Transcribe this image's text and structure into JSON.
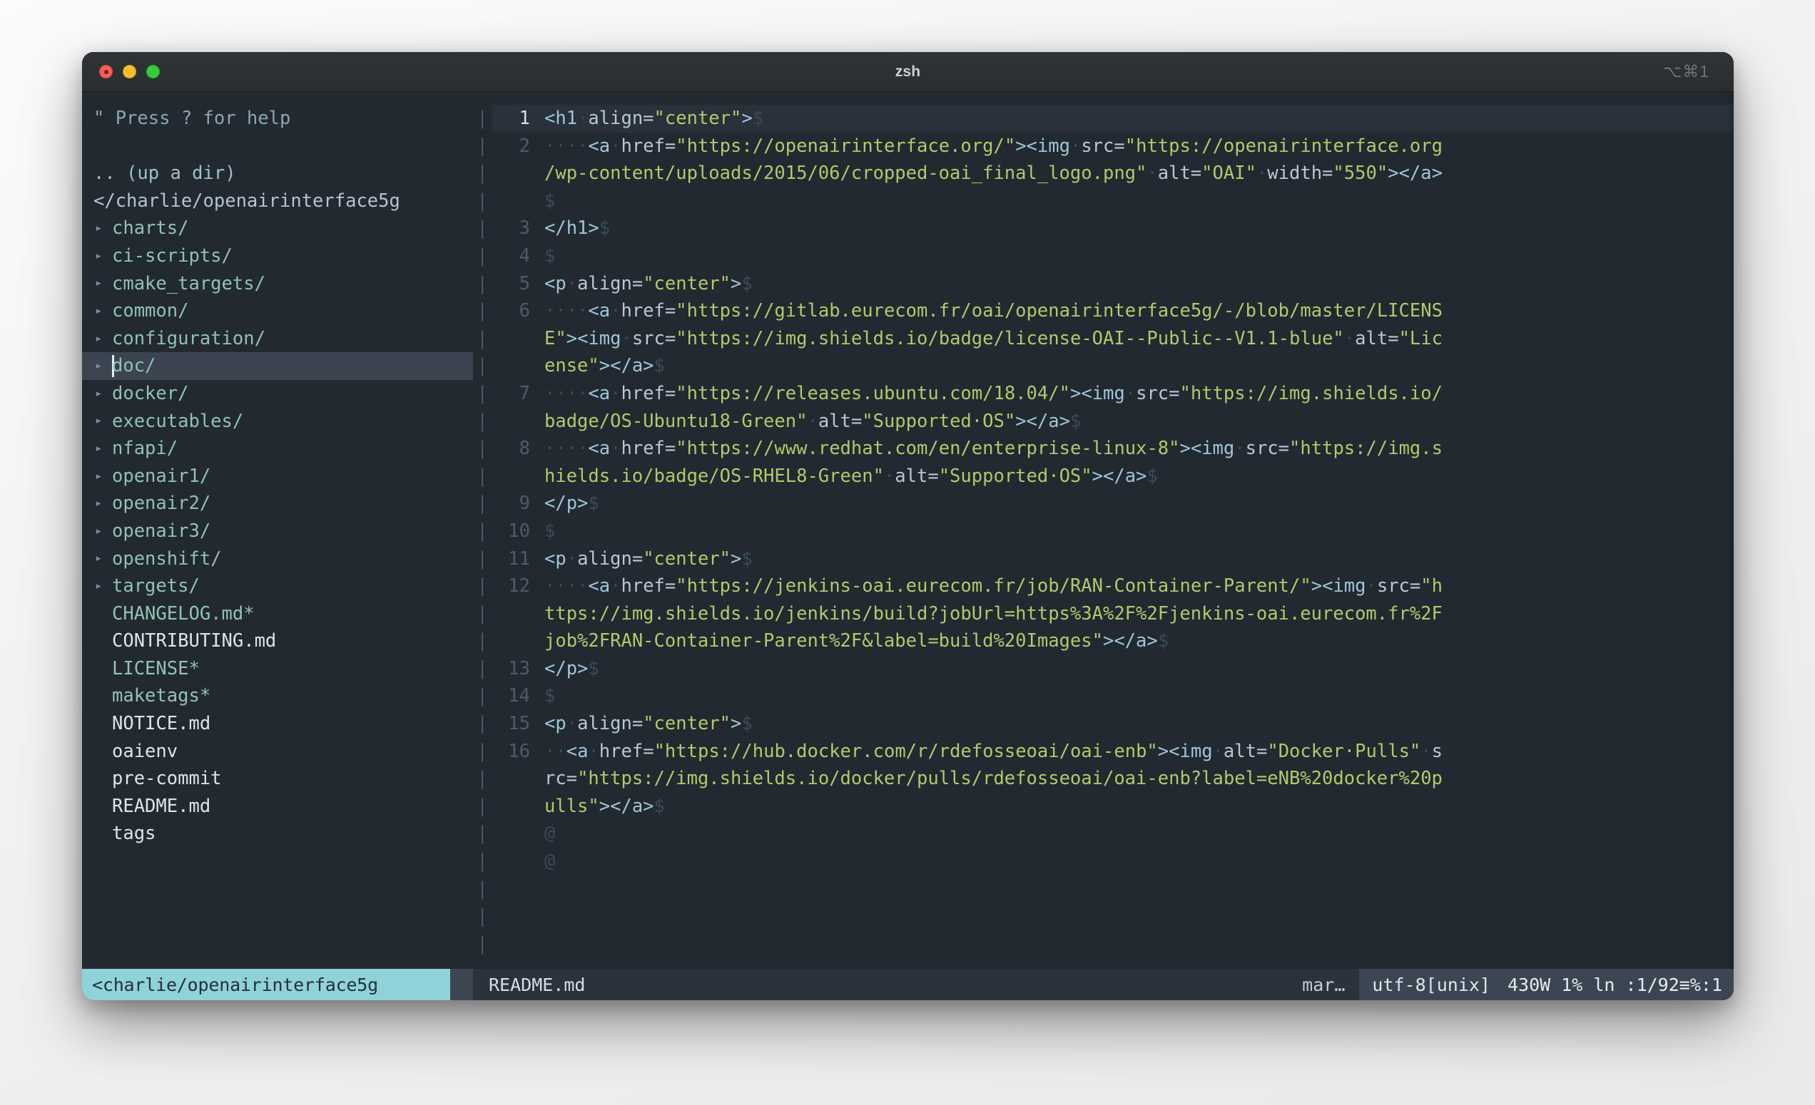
{
  "window": {
    "title": "zsh",
    "shortcut": "⌥⌘1",
    "traffic_lights": [
      "close",
      "minimize",
      "zoom"
    ]
  },
  "tree": {
    "help_hint": "\" Press ? for help",
    "up_dir": ".. (up a dir)",
    "root_path": "</charlie/openairinterface5g",
    "items": [
      {
        "label": "charts/",
        "kind": "dir",
        "arrow": "▸",
        "selected": false
      },
      {
        "label": "ci-scripts/",
        "kind": "dir",
        "arrow": "▸",
        "selected": false
      },
      {
        "label": "cmake_targets/",
        "kind": "dir",
        "arrow": "▸",
        "selected": false
      },
      {
        "label": "common/",
        "kind": "dir",
        "arrow": "▸",
        "selected": false
      },
      {
        "label": "configuration/",
        "kind": "dir",
        "arrow": "▸",
        "selected": false
      },
      {
        "label": "doc/",
        "kind": "dir",
        "arrow": "▸",
        "selected": true
      },
      {
        "label": "docker/",
        "kind": "dir",
        "arrow": "▸",
        "selected": false
      },
      {
        "label": "executables/",
        "kind": "dir",
        "arrow": "▸",
        "selected": false
      },
      {
        "label": "nfapi/",
        "kind": "dir",
        "arrow": "▸",
        "selected": false
      },
      {
        "label": "openair1/",
        "kind": "dir",
        "arrow": "▸",
        "selected": false
      },
      {
        "label": "openair2/",
        "kind": "dir",
        "arrow": "▸",
        "selected": false
      },
      {
        "label": "openair3/",
        "kind": "dir",
        "arrow": "▸",
        "selected": false
      },
      {
        "label": "openshift/",
        "kind": "dir",
        "arrow": "▸",
        "selected": false
      },
      {
        "label": "targets/",
        "kind": "dir",
        "arrow": "▸",
        "selected": false
      },
      {
        "label": "CHANGELOG.md*",
        "kind": "exe",
        "arrow": "",
        "selected": false
      },
      {
        "label": "CONTRIBUTING.md",
        "kind": "file",
        "arrow": "",
        "selected": false
      },
      {
        "label": "LICENSE*",
        "kind": "exe",
        "arrow": "",
        "selected": false
      },
      {
        "label": "maketags*",
        "kind": "exe",
        "arrow": "",
        "selected": false
      },
      {
        "label": "NOTICE.md",
        "kind": "file",
        "arrow": "",
        "selected": false
      },
      {
        "label": "oaienv",
        "kind": "file",
        "arrow": "",
        "selected": false
      },
      {
        "label": "pre-commit",
        "kind": "file",
        "arrow": "",
        "selected": false
      },
      {
        "label": "README.md",
        "kind": "file",
        "arrow": "",
        "selected": false
      },
      {
        "label": "tags",
        "kind": "file",
        "arrow": "",
        "selected": false
      }
    ]
  },
  "editor": {
    "lines": [
      {
        "num": "1",
        "current": true,
        "spans": [
          {
            "t": "tag",
            "v": "<h1"
          },
          {
            "t": "ws",
            "v": "·"
          },
          {
            "t": "attr",
            "v": "align="
          },
          {
            "t": "str",
            "v": "\"center\""
          },
          {
            "t": "tag",
            "v": ">"
          },
          {
            "t": "eol",
            "v": "$"
          }
        ]
      },
      {
        "num": "2",
        "current": false,
        "spans": [
          {
            "t": "ws",
            "v": "····"
          },
          {
            "t": "tag",
            "v": "<a"
          },
          {
            "t": "ws",
            "v": "·"
          },
          {
            "t": "attr",
            "v": "href="
          },
          {
            "t": "str",
            "v": "\"https://openairinterface.org/\""
          },
          {
            "t": "tag",
            "v": ">"
          },
          {
            "t": "tag",
            "v": "<img"
          },
          {
            "t": "ws",
            "v": "·"
          },
          {
            "t": "attr",
            "v": "src="
          },
          {
            "t": "str",
            "v": "\"https://openairinterface.org"
          }
        ]
      },
      {
        "num": "",
        "current": false,
        "spans": [
          {
            "t": "str",
            "v": "/wp-content/uploads/2015/06/cropped-oai_final_logo.png\""
          },
          {
            "t": "ws",
            "v": "·"
          },
          {
            "t": "attr",
            "v": "alt="
          },
          {
            "t": "str",
            "v": "\"OAI\""
          },
          {
            "t": "ws",
            "v": "·"
          },
          {
            "t": "attr",
            "v": "width="
          },
          {
            "t": "str",
            "v": "\"550\""
          },
          {
            "t": "tag",
            "v": ">"
          },
          {
            "t": "tag",
            "v": "</a>"
          }
        ]
      },
      {
        "num": "",
        "current": false,
        "spans": [
          {
            "t": "eol",
            "v": "$"
          }
        ]
      },
      {
        "num": "3",
        "current": false,
        "spans": [
          {
            "t": "tag",
            "v": "</h1>"
          },
          {
            "t": "eol",
            "v": "$"
          }
        ]
      },
      {
        "num": "4",
        "current": false,
        "spans": [
          {
            "t": "eol",
            "v": "$"
          }
        ]
      },
      {
        "num": "5",
        "current": false,
        "spans": [
          {
            "t": "tag",
            "v": "<p"
          },
          {
            "t": "ws",
            "v": "·"
          },
          {
            "t": "attr",
            "v": "align="
          },
          {
            "t": "str",
            "v": "\"center\""
          },
          {
            "t": "tag",
            "v": ">"
          },
          {
            "t": "eol",
            "v": "$"
          }
        ]
      },
      {
        "num": "6",
        "current": false,
        "spans": [
          {
            "t": "ws",
            "v": "····"
          },
          {
            "t": "tag",
            "v": "<a"
          },
          {
            "t": "ws",
            "v": "·"
          },
          {
            "t": "attr",
            "v": "href="
          },
          {
            "t": "str",
            "v": "\"https://gitlab.eurecom.fr/oai/openairinterface5g/-/blob/master/LICENS"
          }
        ]
      },
      {
        "num": "",
        "current": false,
        "spans": [
          {
            "t": "str",
            "v": "E\""
          },
          {
            "t": "tag",
            "v": ">"
          },
          {
            "t": "tag",
            "v": "<img"
          },
          {
            "t": "ws",
            "v": "·"
          },
          {
            "t": "attr",
            "v": "src="
          },
          {
            "t": "str",
            "v": "\"https://img.shields.io/badge/license-OAI--Public--V1.1-blue\""
          },
          {
            "t": "ws",
            "v": "·"
          },
          {
            "t": "attr",
            "v": "alt="
          },
          {
            "t": "str",
            "v": "\"Lic"
          }
        ]
      },
      {
        "num": "",
        "current": false,
        "spans": [
          {
            "t": "str",
            "v": "ense\""
          },
          {
            "t": "tag",
            "v": ">"
          },
          {
            "t": "tag",
            "v": "</a>"
          },
          {
            "t": "eol",
            "v": "$"
          }
        ]
      },
      {
        "num": "7",
        "current": false,
        "spans": [
          {
            "t": "ws",
            "v": "····"
          },
          {
            "t": "tag",
            "v": "<a"
          },
          {
            "t": "ws",
            "v": "·"
          },
          {
            "t": "attr",
            "v": "href="
          },
          {
            "t": "str",
            "v": "\"https://releases.ubuntu.com/18.04/\""
          },
          {
            "t": "tag",
            "v": ">"
          },
          {
            "t": "tag",
            "v": "<img"
          },
          {
            "t": "ws",
            "v": "·"
          },
          {
            "t": "attr",
            "v": "src="
          },
          {
            "t": "str",
            "v": "\"https://img.shields.io/"
          }
        ]
      },
      {
        "num": "",
        "current": false,
        "spans": [
          {
            "t": "str",
            "v": "badge/OS-Ubuntu18-Green\""
          },
          {
            "t": "ws",
            "v": "·"
          },
          {
            "t": "attr",
            "v": "alt="
          },
          {
            "t": "str",
            "v": "\"Supported·OS\""
          },
          {
            "t": "tag",
            "v": ">"
          },
          {
            "t": "tag",
            "v": "</a>"
          },
          {
            "t": "eol",
            "v": "$"
          }
        ]
      },
      {
        "num": "8",
        "current": false,
        "spans": [
          {
            "t": "ws",
            "v": "····"
          },
          {
            "t": "tag",
            "v": "<a"
          },
          {
            "t": "ws",
            "v": "·"
          },
          {
            "t": "attr",
            "v": "href="
          },
          {
            "t": "str",
            "v": "\"https://www.redhat.com/en/enterprise-linux-8\""
          },
          {
            "t": "tag",
            "v": ">"
          },
          {
            "t": "tag",
            "v": "<img"
          },
          {
            "t": "ws",
            "v": "·"
          },
          {
            "t": "attr",
            "v": "src="
          },
          {
            "t": "str",
            "v": "\"https://img.s"
          }
        ]
      },
      {
        "num": "",
        "current": false,
        "spans": [
          {
            "t": "str",
            "v": "hields.io/badge/OS-RHEL8-Green\""
          },
          {
            "t": "ws",
            "v": "·"
          },
          {
            "t": "attr",
            "v": "alt="
          },
          {
            "t": "str",
            "v": "\"Supported·OS\""
          },
          {
            "t": "tag",
            "v": ">"
          },
          {
            "t": "tag",
            "v": "</a>"
          },
          {
            "t": "eol",
            "v": "$"
          }
        ]
      },
      {
        "num": "9",
        "current": false,
        "spans": [
          {
            "t": "tag",
            "v": "</p>"
          },
          {
            "t": "eol",
            "v": "$"
          }
        ]
      },
      {
        "num": "10",
        "current": false,
        "spans": [
          {
            "t": "eol",
            "v": "$"
          }
        ]
      },
      {
        "num": "11",
        "current": false,
        "spans": [
          {
            "t": "tag",
            "v": "<p"
          },
          {
            "t": "ws",
            "v": "·"
          },
          {
            "t": "attr",
            "v": "align="
          },
          {
            "t": "str",
            "v": "\"center\""
          },
          {
            "t": "tag",
            "v": ">"
          },
          {
            "t": "eol",
            "v": "$"
          }
        ]
      },
      {
        "num": "12",
        "current": false,
        "spans": [
          {
            "t": "ws",
            "v": "····"
          },
          {
            "t": "tag",
            "v": "<a"
          },
          {
            "t": "ws",
            "v": "·"
          },
          {
            "t": "attr",
            "v": "href="
          },
          {
            "t": "str",
            "v": "\"https://jenkins-oai.eurecom.fr/job/RAN-Container-Parent/\""
          },
          {
            "t": "tag",
            "v": ">"
          },
          {
            "t": "tag",
            "v": "<img"
          },
          {
            "t": "ws",
            "v": "·"
          },
          {
            "t": "attr",
            "v": "src="
          },
          {
            "t": "str",
            "v": "\"h"
          }
        ]
      },
      {
        "num": "",
        "current": false,
        "spans": [
          {
            "t": "str",
            "v": "ttps://img.shields.io/jenkins/build?jobUrl=https%3A%2F%2Fjenkins-oai.eurecom.fr%2F"
          }
        ]
      },
      {
        "num": "",
        "current": false,
        "spans": [
          {
            "t": "str",
            "v": "job%2FRAN-Container-Parent%2F&label=build%20Images\""
          },
          {
            "t": "tag",
            "v": ">"
          },
          {
            "t": "tag",
            "v": "</a>"
          },
          {
            "t": "eol",
            "v": "$"
          }
        ]
      },
      {
        "num": "13",
        "current": false,
        "spans": [
          {
            "t": "tag",
            "v": "</p>"
          },
          {
            "t": "eol",
            "v": "$"
          }
        ]
      },
      {
        "num": "14",
        "current": false,
        "spans": [
          {
            "t": "eol",
            "v": "$"
          }
        ]
      },
      {
        "num": "15",
        "current": false,
        "spans": [
          {
            "t": "tag",
            "v": "<p"
          },
          {
            "t": "ws",
            "v": "·"
          },
          {
            "t": "attr",
            "v": "align="
          },
          {
            "t": "str",
            "v": "\"center\""
          },
          {
            "t": "tag",
            "v": ">"
          },
          {
            "t": "eol",
            "v": "$"
          }
        ]
      },
      {
        "num": "16",
        "current": false,
        "spans": [
          {
            "t": "ws",
            "v": "··"
          },
          {
            "t": "tag",
            "v": "<a"
          },
          {
            "t": "ws",
            "v": "·"
          },
          {
            "t": "attr",
            "v": "href="
          },
          {
            "t": "str",
            "v": "\"https://hub.docker.com/r/rdefosseoai/oai-enb\""
          },
          {
            "t": "tag",
            "v": ">"
          },
          {
            "t": "tag",
            "v": "<img"
          },
          {
            "t": "ws",
            "v": "·"
          },
          {
            "t": "attr",
            "v": "alt="
          },
          {
            "t": "str",
            "v": "\"Docker·Pulls\""
          },
          {
            "t": "ws",
            "v": "·"
          },
          {
            "t": "attr",
            "v": "s"
          }
        ]
      },
      {
        "num": "",
        "current": false,
        "spans": [
          {
            "t": "attr",
            "v": "rc="
          },
          {
            "t": "str",
            "v": "\"https://img.shields.io/docker/pulls/rdefosseoai/oai-enb?label=eNB%20docker%20p"
          }
        ]
      },
      {
        "num": "",
        "current": false,
        "spans": [
          {
            "t": "str",
            "v": "ulls\""
          },
          {
            "t": "tag",
            "v": ">"
          },
          {
            "t": "tag",
            "v": "</a>"
          },
          {
            "t": "eol",
            "v": "$"
          }
        ]
      },
      {
        "num": "",
        "current": false,
        "spans": [
          {
            "t": "tilde",
            "v": "@"
          }
        ]
      },
      {
        "num": "",
        "current": false,
        "spans": [
          {
            "t": "tilde",
            "v": "@"
          }
        ]
      }
    ]
  },
  "statusline": {
    "tree_mode": "<charlie/openairinterface5g",
    "filename": "README.md",
    "filetype": "mar…",
    "encoding": "utf-8[unix]",
    "position": "430W 1% ln :1/92≡%:1"
  }
}
